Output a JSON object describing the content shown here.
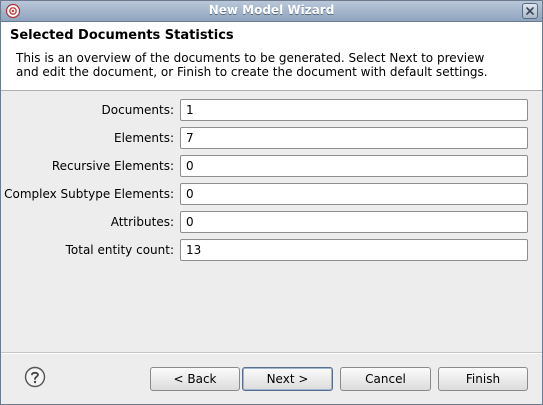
{
  "window": {
    "title": "New Model Wizard"
  },
  "header": {
    "title": "Selected Documents Statistics",
    "description": "This is an overview of the documents to be generated.  Select Next to preview and edit the document, or Finish to create the document with default settings."
  },
  "form": {
    "rows": [
      {
        "label": "Documents:",
        "value": "1"
      },
      {
        "label": "Elements:",
        "value": "7"
      },
      {
        "label": "Recursive Elements:",
        "value": "0"
      },
      {
        "label": "Complex Subtype Elements:",
        "value": "0"
      },
      {
        "label": "Attributes:",
        "value": "0"
      },
      {
        "label": "Total entity count:",
        "value": "13"
      }
    ]
  },
  "buttons": {
    "back": "< Back",
    "next": "Next >",
    "cancel": "Cancel",
    "finish": "Finish"
  },
  "icons": {
    "app": "eclipse-wizard-icon",
    "close": "close-icon",
    "help": "help-icon"
  },
  "colors": {
    "titlebar": "#8ea4bf",
    "background": "#ededed",
    "header_background": "#ffffff"
  }
}
